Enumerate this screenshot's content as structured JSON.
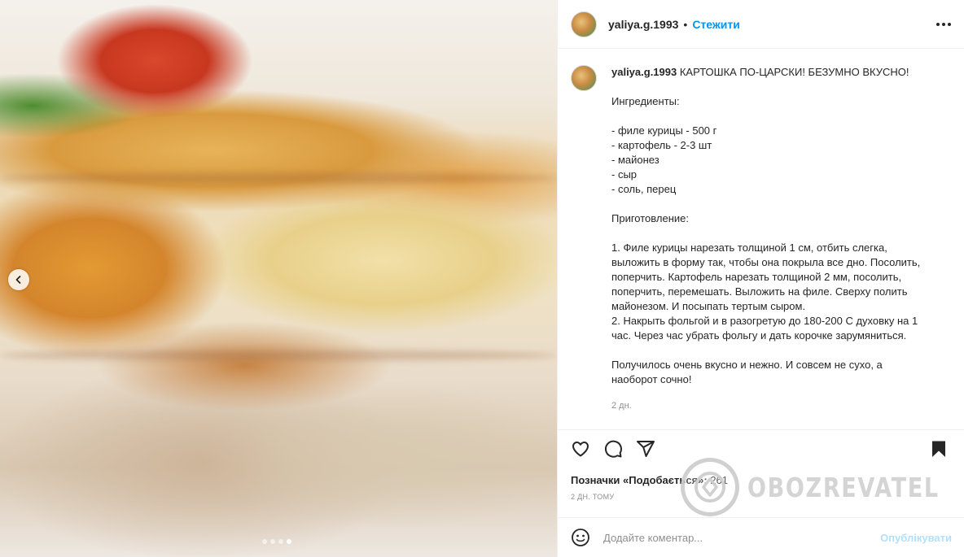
{
  "post": {
    "username": "yaliya.g.1993",
    "separator": "•",
    "follow_label": "Стежити",
    "caption": {
      "username": "yaliya.g.1993",
      "title": "КАРТОШКА ПО-ЦАРСКИ! БЕЗУМНО ВКУСНО!",
      "ingredients_heading": "Ингредиенты:",
      "ingredients": [
        "- филе курицы - 500 г",
        "- картофель - 2-3 шт",
        "- майонез",
        "- сыр",
        "- соль, перец"
      ],
      "preparation_heading": "Приготовление:",
      "steps_lines": [
        "1. Филе курицы нарезать толщиной 1 см, отбить слегка,",
        "выложить в форму так, чтобы она покрыла все дно. Посолить,",
        "поперчить. Картофель нарезать толщиной 2 мм, посолить,",
        "поперчить, перемешать. Выложить на филе. Сверху полить",
        "майонезом. И посыпать тертым сыром.",
        "2. Накрыть фольгой и в разогретую до 180-200 С духовку на 1",
        "час. Через час убрать фольгу и дать корочке зарумяниться."
      ],
      "closing_lines": [
        "Получилось очень вкусно и нежно. И совсем не сухо, а",
        "наоборот сочно!"
      ],
      "age": "2 дн."
    },
    "likes_label": "Позначки «Подобається»: ",
    "likes_count": "261",
    "date": "2 дн. тому",
    "comment_placeholder": "Додайте коментар...",
    "publish_label": "Опублікувати"
  },
  "carousel": {
    "slide_count": 4,
    "active_index": 3
  },
  "watermark": {
    "text": "OBOZREVATEL"
  },
  "colors": {
    "accent": "#0095f6",
    "publish_disabled": "#b2dffc",
    "muted": "#8e8e8e",
    "text": "#262626"
  },
  "icons": [
    "chevron-left-icon",
    "more-icon",
    "heart-icon",
    "comment-icon",
    "share-icon",
    "bookmark-icon",
    "emoji-icon",
    "obozrevatel-logo-icon"
  ]
}
